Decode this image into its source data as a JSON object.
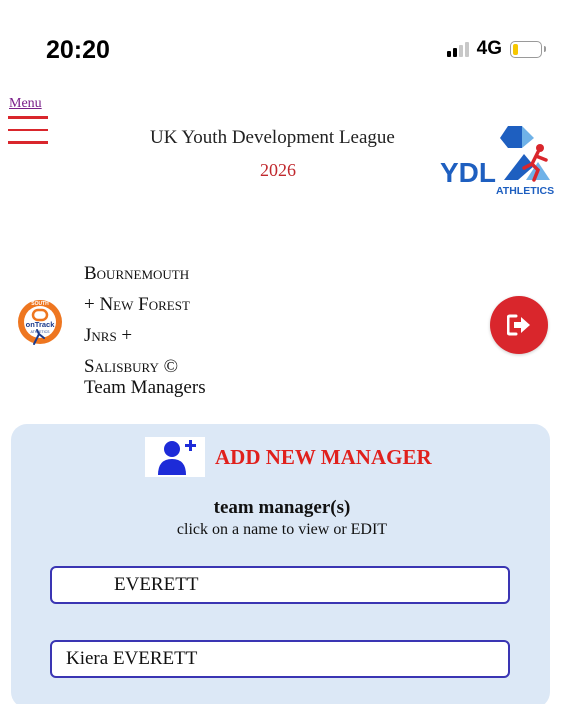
{
  "status_bar": {
    "time": "20:20",
    "network": "4G",
    "signal_bars_on": 2,
    "battery_fraction": 0.2,
    "battery_color": "#f6c700"
  },
  "header": {
    "menu_label": "Menu",
    "title": "UK Youth Development League",
    "year": "2026",
    "logo_text": "YDL",
    "logo_subtext": "ATHLETICS"
  },
  "club": {
    "name_lines": [
      "Bournemouth",
      "+ New Forest",
      "Jnrs +",
      "Salisbury ©"
    ],
    "subtitle": "Team Managers",
    "logo_text": "onTrack",
    "logo_top": "SOUTH",
    "logo_bottom": "ATHLETICS"
  },
  "panel": {
    "add_label": "ADD NEW MANAGER",
    "heading": "team manager(s)",
    "subheading": "click on a name to view or EDIT",
    "managers": [
      "EVERETT",
      "Kiera EVERETT"
    ]
  },
  "colors": {
    "accent_red": "#d9262c",
    "panel_bg": "#dce8f6",
    "field_border": "#3a35b3",
    "add_text": "#e0201c",
    "icon_blue": "#1d2bd8"
  },
  "icons": {
    "menu": "hamburger-icon",
    "logout": "logout-icon",
    "add_user": "add-user-icon"
  }
}
